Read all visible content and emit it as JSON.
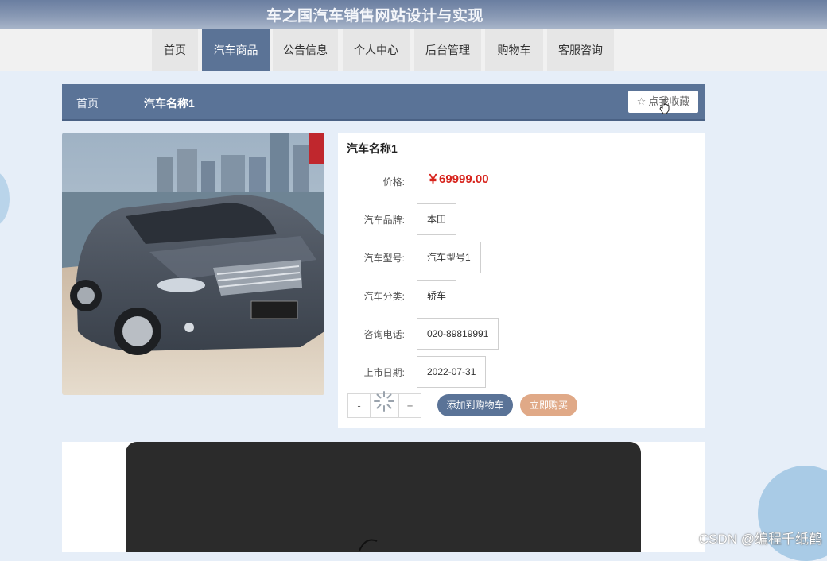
{
  "site_title": "车之国汽车销售网站设计与实现",
  "nav": [
    {
      "label": "首页"
    },
    {
      "label": "汽车商品"
    },
    {
      "label": "公告信息"
    },
    {
      "label": "个人中心"
    },
    {
      "label": "后台管理"
    },
    {
      "label": "购物车"
    },
    {
      "label": "客服咨询"
    }
  ],
  "nav_active_index": 1,
  "breadcrumb": {
    "home": "首页",
    "current": "汽车名称1"
  },
  "favorite_label": "点我收藏",
  "product": {
    "name": "汽车名称1",
    "price_label": "价格:",
    "price_value": "￥69999.00",
    "fields": [
      {
        "label": "汽车品牌:",
        "value": "本田"
      },
      {
        "label": "汽车型号:",
        "value": "汽车型号1"
      },
      {
        "label": "汽车分类:",
        "value": "轿车"
      },
      {
        "label": "咨询电话:",
        "value": "020-89819991"
      },
      {
        "label": "上市日期:",
        "value": "2022-07-31"
      }
    ],
    "quantity": {
      "minus": "-",
      "plus": "+",
      "value": ""
    },
    "add_to_cart_label": "添加到购物车",
    "buy_now_label": "立即购买"
  },
  "watermark": "CSDN @编程千纸鹤",
  "colors": {
    "primary": "#5a7397",
    "price": "#d7241d",
    "buy": "#e0a987"
  }
}
